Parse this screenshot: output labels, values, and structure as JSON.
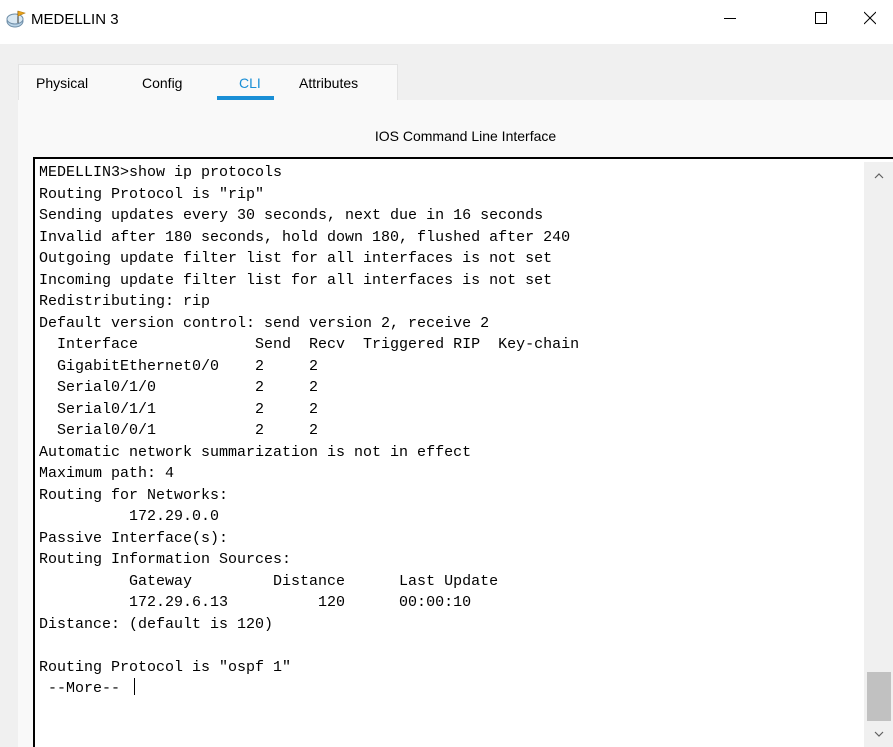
{
  "window": {
    "title": "MEDELLIN 3",
    "icon": "router-icon",
    "controls": {
      "minimize": "minimize-icon",
      "maximize": "maximize-icon",
      "close": "close-icon"
    }
  },
  "tabs": [
    {
      "label": "Physical",
      "active": false
    },
    {
      "label": "Config",
      "active": false
    },
    {
      "label": "CLI",
      "active": true
    },
    {
      "label": "Attributes",
      "active": false
    }
  ],
  "panel": {
    "title": "IOS Command Line Interface"
  },
  "terminal": {
    "lines": [
      "MEDELLIN3>show ip protocols",
      "Routing Protocol is \"rip\"",
      "Sending updates every 30 seconds, next due in 16 seconds",
      "Invalid after 180 seconds, hold down 180, flushed after 240",
      "Outgoing update filter list for all interfaces is not set",
      "Incoming update filter list for all interfaces is not set",
      "Redistributing: rip",
      "Default version control: send version 2, receive 2",
      "  Interface             Send  Recv  Triggered RIP  Key-chain",
      "  GigabitEthernet0/0    2     2",
      "  Serial0/1/0           2     2",
      "  Serial0/1/1           2     2",
      "  Serial0/0/1           2     2",
      "Automatic network summarization is not in effect",
      "Maximum path: 4",
      "Routing for Networks:",
      "          172.29.0.0",
      "Passive Interface(s):",
      "Routing Information Sources:",
      "          Gateway         Distance      Last Update",
      "          172.29.6.13          120      00:00:10",
      "Distance: (default is 120)",
      "",
      "Routing Protocol is \"ospf 1\"",
      " --More-- "
    ]
  },
  "colors": {
    "accent": "#1a8fd6",
    "client_bg": "#f0f0f0",
    "panel_bg": "#f9f9f9",
    "terminal_bg": "#ffffff"
  }
}
